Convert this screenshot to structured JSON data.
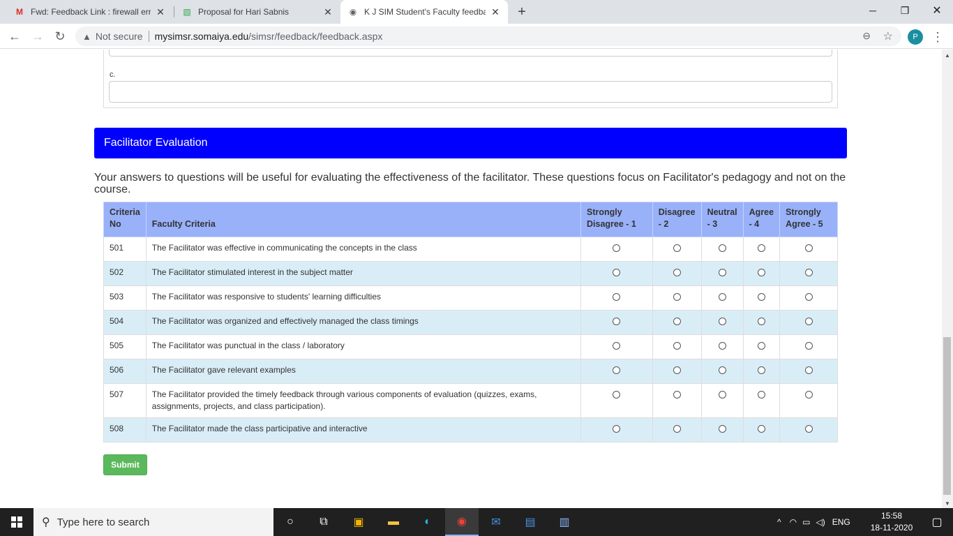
{
  "browser": {
    "tabs": [
      {
        "title": "Fwd: Feedback Link : firewall erro",
        "icon": "gmail-icon"
      },
      {
        "title": "Proposal for Hari Sabnis",
        "icon": "maps-icon"
      },
      {
        "title": "K J SIM Student's Faculty feedbac",
        "icon": "globe-icon"
      }
    ],
    "security_label": "Not secure",
    "url_host": "mysimsr.somaiya.edu",
    "url_path": "/simsr/feedback/feedback.aspx",
    "profile_initial": "P"
  },
  "form": {
    "field_c_label": "c.",
    "section_title": "Facilitator Evaluation",
    "intro": "Your answers to questions will be useful for evaluating the effectiveness of the facilitator. These questions focus on Facilitator's pedagogy and not on the course.",
    "columns": {
      "no": "Criteria No",
      "criteria": "Faculty Criteria",
      "r1": "Strongly Disagree - 1",
      "r2": "Disagree - 2",
      "r3": "Neutral - 3",
      "r4": "Agree - 4",
      "r5": "Strongly Agree - 5"
    },
    "rows": [
      {
        "no": "501",
        "text": "The Facilitator was effective in communicating the concepts in the class"
      },
      {
        "no": "502",
        "text": "The Facilitator stimulated interest in the subject matter"
      },
      {
        "no": "503",
        "text": "The Facilitator was responsive to students' learning difficulties"
      },
      {
        "no": "504",
        "text": "The Facilitator was organized and effectively managed the class timings"
      },
      {
        "no": "505",
        "text": "The Facilitator was punctual in the class / laboratory"
      },
      {
        "no": "506",
        "text": "The Facilitator gave relevant examples"
      },
      {
        "no": "507",
        "text": "The Facilitator provided the timely feedback through various components of evaluation (quizzes, exams, assignments, projects, and class participation)."
      },
      {
        "no": "508",
        "text": "The Facilitator made the class participative and interactive"
      }
    ],
    "submit_label": "Submit"
  },
  "taskbar": {
    "search_placeholder": "Type here to search",
    "language": "ENG",
    "time": "15:58",
    "date": "18-11-2020"
  },
  "colors": {
    "section_header": "#0000ff",
    "table_header": "#99b1f9",
    "row_alt": "#d9edf7",
    "submit": "#5cb85c"
  }
}
